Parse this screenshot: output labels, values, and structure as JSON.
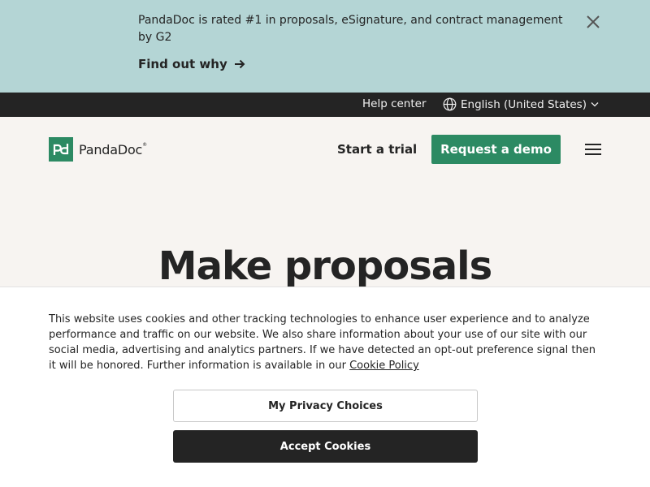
{
  "announcement": {
    "text": "PandaDoc is rated #1 in proposals, eSignature, and contract management by G2",
    "link_label": "Find out why",
    "link_icon": "arrow-right-icon",
    "close_icon": "close-icon"
  },
  "utility_bar": {
    "help_label": "Help center",
    "language_label": "English (United States)",
    "globe_icon": "globe-icon",
    "chevron_icon": "chevron-down-icon"
  },
  "header": {
    "logo_text": "PandaDoc",
    "logo_reg": "®",
    "trial_label": "Start a trial",
    "demo_label": "Request a demo",
    "menu_icon": "hamburger-menu-icon"
  },
  "hero": {
    "title": "Make proposals"
  },
  "cookie": {
    "text": "This website uses cookies and other tracking technologies to enhance user experience and to analyze performance and traffic on our website. We also share information about your use of our site with our social media, advertising and analytics partners. If we have detected an opt-out preference signal then it will be honored. Further information is available in our",
    "policy_link": "Cookie Policy",
    "privacy_button": "My Privacy Choices",
    "accept_button": "Accept Cookies"
  },
  "colors": {
    "banner_bg": "#b4d5d5",
    "brand_green": "#2c8a63",
    "dark": "#242424",
    "page_bg": "#f7f4f1"
  }
}
